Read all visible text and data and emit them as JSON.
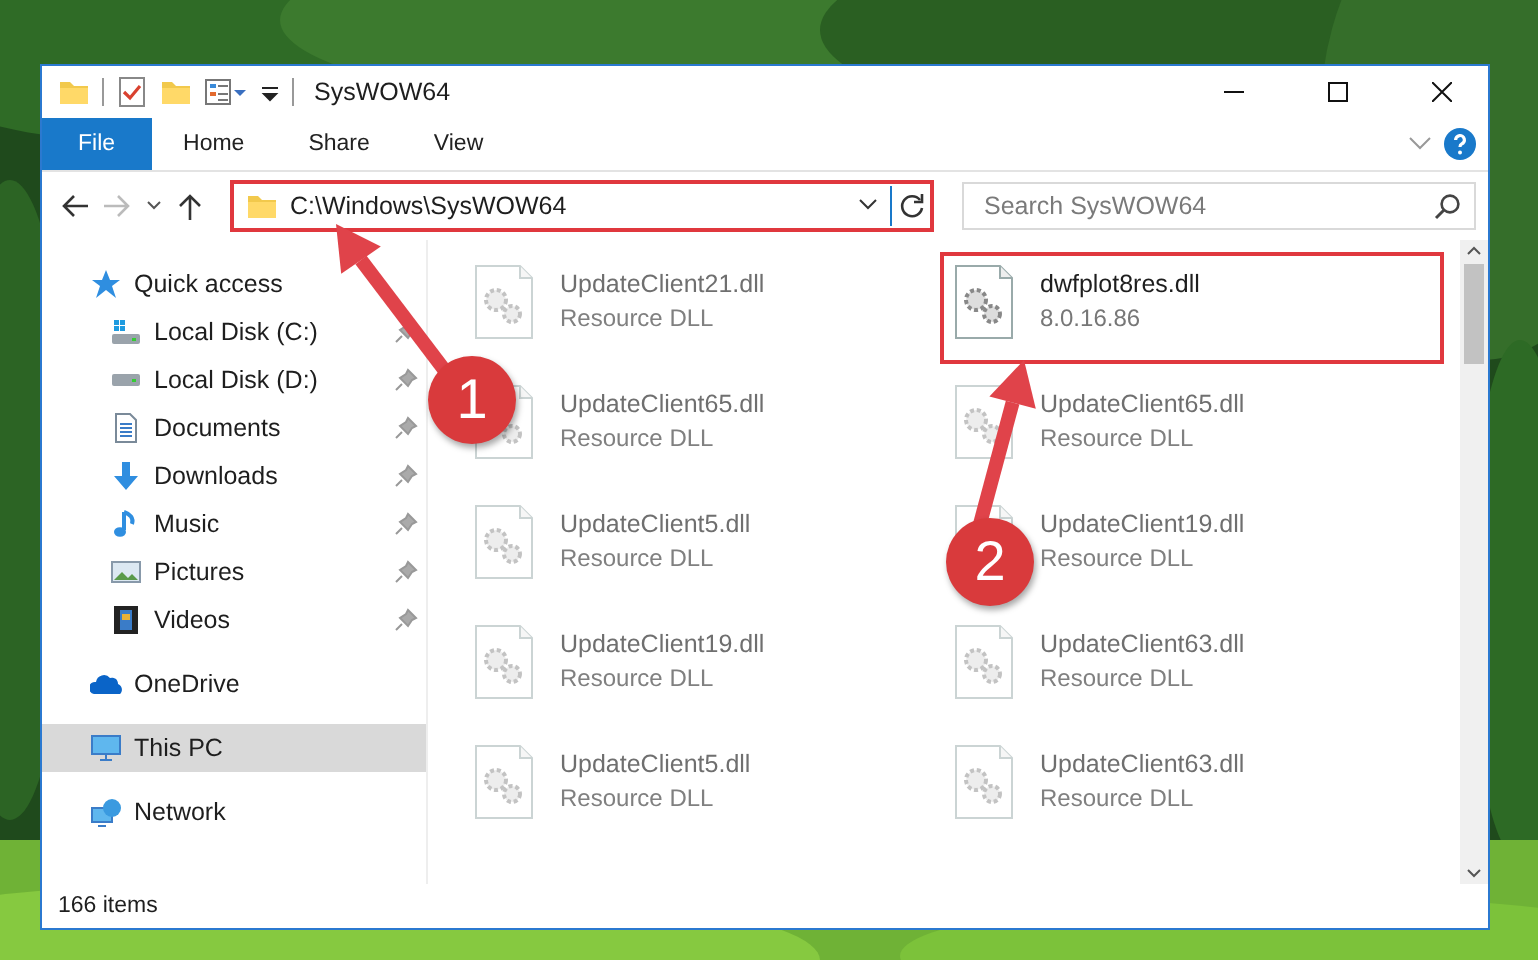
{
  "window": {
    "title": "SysWOW64"
  },
  "ribbon_tabs": [
    {
      "label": "File",
      "kind": "file"
    },
    {
      "label": "Home",
      "kind": "tab"
    },
    {
      "label": "Share",
      "kind": "tab"
    },
    {
      "label": "View",
      "kind": "tab"
    }
  ],
  "address": {
    "path": "C:\\Windows\\SysWOW64",
    "highlighted": true
  },
  "search": {
    "placeholder": "Search SysWOW64"
  },
  "sidebar": {
    "items": [
      {
        "label": "Quick access",
        "kind": "quick-access",
        "selected": false,
        "children": [
          {
            "label": "Local Disk (C:)",
            "kind": "drive-windows",
            "pinned": true
          },
          {
            "label": "Local Disk (D:)",
            "kind": "drive",
            "pinned": true
          },
          {
            "label": "Documents",
            "kind": "documents",
            "pinned": true
          },
          {
            "label": "Downloads",
            "kind": "downloads",
            "pinned": true
          },
          {
            "label": "Music",
            "kind": "music",
            "pinned": true
          },
          {
            "label": "Pictures",
            "kind": "pictures",
            "pinned": true
          },
          {
            "label": "Videos",
            "kind": "videos",
            "pinned": true
          }
        ]
      },
      {
        "label": "OneDrive",
        "kind": "onedrive",
        "selected": false
      },
      {
        "label": "This PC",
        "kind": "pc",
        "selected": true
      },
      {
        "label": "Network",
        "kind": "network",
        "selected": false
      }
    ]
  },
  "files": [
    {
      "name": "UpdateClient21.dll",
      "detail": "Resource DLL",
      "blurred": true,
      "highlighted": false
    },
    {
      "name": "dwfplot8res.dll",
      "detail": "8.0.16.86",
      "blurred": false,
      "highlighted": true
    },
    {
      "name": "UpdateClient65.dll",
      "detail": "Resource DLL",
      "blurred": true,
      "highlighted": false
    },
    {
      "name": "UpdateClient65.dll",
      "detail": "Resource DLL",
      "blurred": true,
      "highlighted": false
    },
    {
      "name": "UpdateClient5.dll",
      "detail": "Resource DLL",
      "blurred": true,
      "highlighted": false
    },
    {
      "name": "UpdateClient19.dll",
      "detail": "Resource DLL",
      "blurred": true,
      "highlighted": false
    },
    {
      "name": "UpdateClient19.dll",
      "detail": "Resource DLL",
      "blurred": true,
      "highlighted": false
    },
    {
      "name": "UpdateClient63.dll",
      "detail": "Resource DLL",
      "blurred": true,
      "highlighted": false
    },
    {
      "name": "UpdateClient5.dll",
      "detail": "Resource DLL",
      "blurred": true,
      "highlighted": false
    },
    {
      "name": "UpdateClient63.dll",
      "detail": "Resource DLL",
      "blurred": true,
      "highlighted": false
    }
  ],
  "callouts": [
    {
      "number": "1"
    },
    {
      "number": "2"
    }
  ],
  "status_bar": {
    "text": "166 items"
  }
}
